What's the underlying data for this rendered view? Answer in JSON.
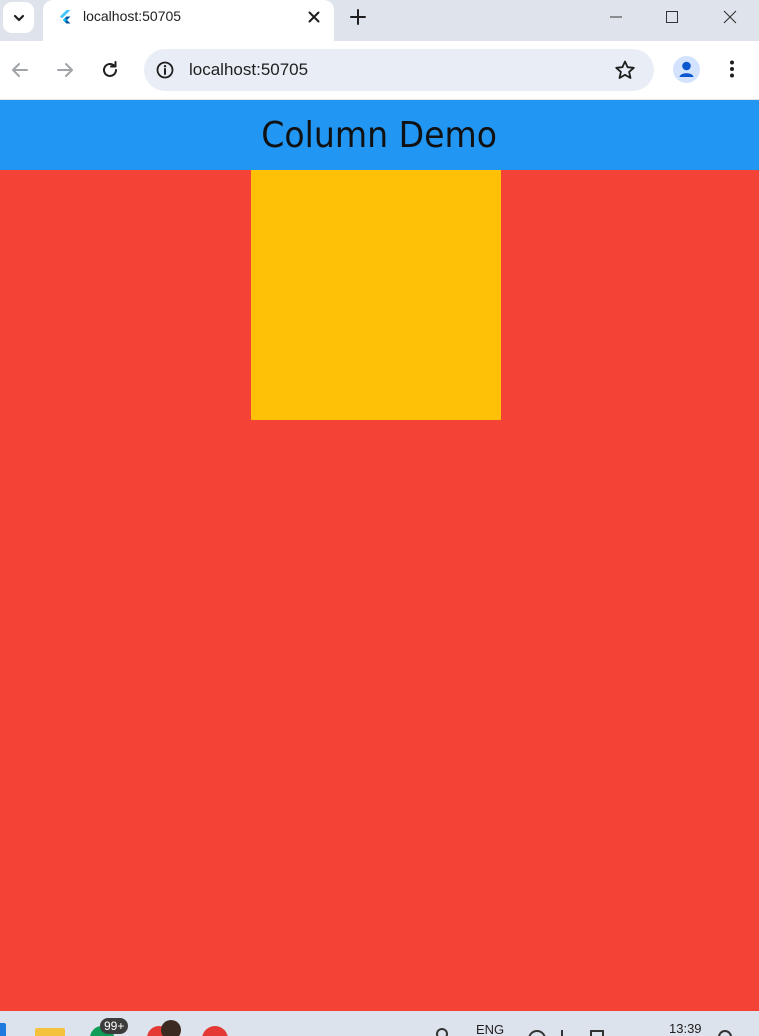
{
  "browser": {
    "tab": {
      "title": "localhost:50705",
      "favicon": "flutter-icon"
    },
    "toolbar": {
      "url": "localhost:50705"
    }
  },
  "app": {
    "title": "Column Demo",
    "colors": {
      "app_bar": "#2196f3",
      "body_background": "#f44336",
      "box": "#ffc107"
    }
  },
  "taskbar": {
    "notification_badge": "99+",
    "language": "ENG",
    "clock": "13:39"
  }
}
